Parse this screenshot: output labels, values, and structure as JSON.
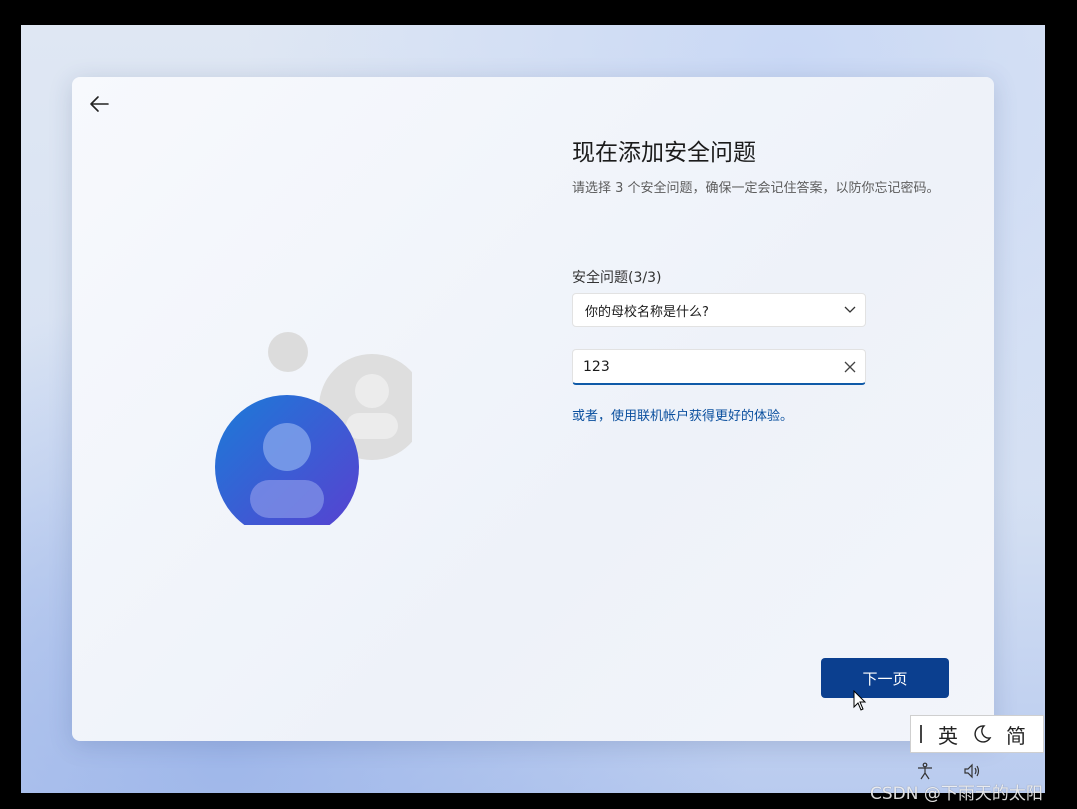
{
  "page": {
    "title": "现在添加安全问题",
    "description": "请选择 3 个安全问题，确保一定会记住答案，以防你忘记密码。",
    "field_label": "安全问题(3/3)",
    "question_selected": "你的母校名称是什么?",
    "answer_value": "123",
    "online_account_link": "或者，使用联机帐户获得更好的体验。",
    "next_label": "下一页"
  },
  "icons": {
    "back": "back-arrow-icon",
    "chevron": "chevron-down-icon",
    "clear": "close-icon",
    "accessibility": "accessibility-icon",
    "volume": "volume-icon",
    "moon": "moon-icon"
  },
  "ime": {
    "lang": "英",
    "script": "简"
  },
  "watermark": "CSDN @下雨天的太阳",
  "colors": {
    "accent": "#0b3f8f",
    "link": "#0a4f9e",
    "avatar_blue": "#2f63d8",
    "avatar_grey": "#dcdcdc"
  }
}
